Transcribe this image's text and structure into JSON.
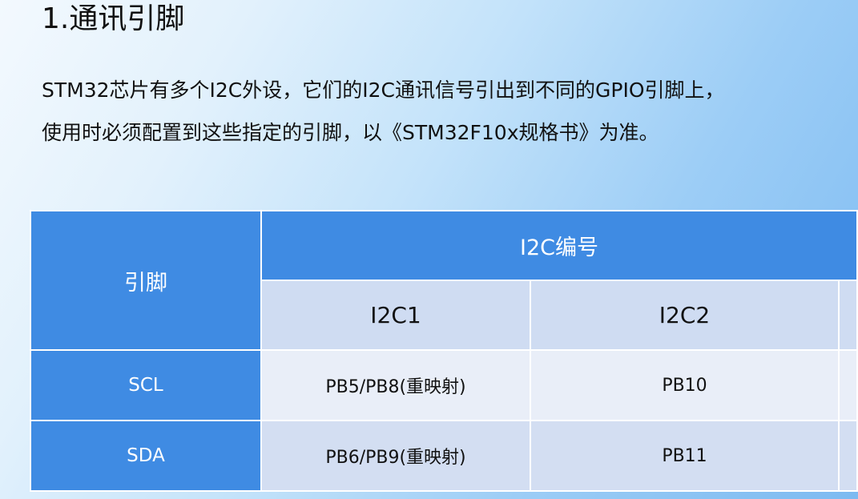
{
  "slide": {
    "title": "1.通讯引脚",
    "paragraph_lines": [
      "STM32芯片有多个I2C外设，它们的I2C通讯信号引出到不同的GPIO引脚上，",
      "使用时必须配置到这些指定的引脚，以《STM32F10x规格书》为准。"
    ]
  },
  "table": {
    "corner_header": "引脚",
    "group_header": "I2C编号",
    "columns": [
      "I2C1",
      "I2C2"
    ],
    "rows": [
      {
        "label": "SCL",
        "values": [
          "PB5/PB8(重映射)",
          "PB10"
        ]
      },
      {
        "label": "SDA",
        "values": [
          "PB6/PB9(重映射)",
          "PB11"
        ]
      }
    ]
  }
}
